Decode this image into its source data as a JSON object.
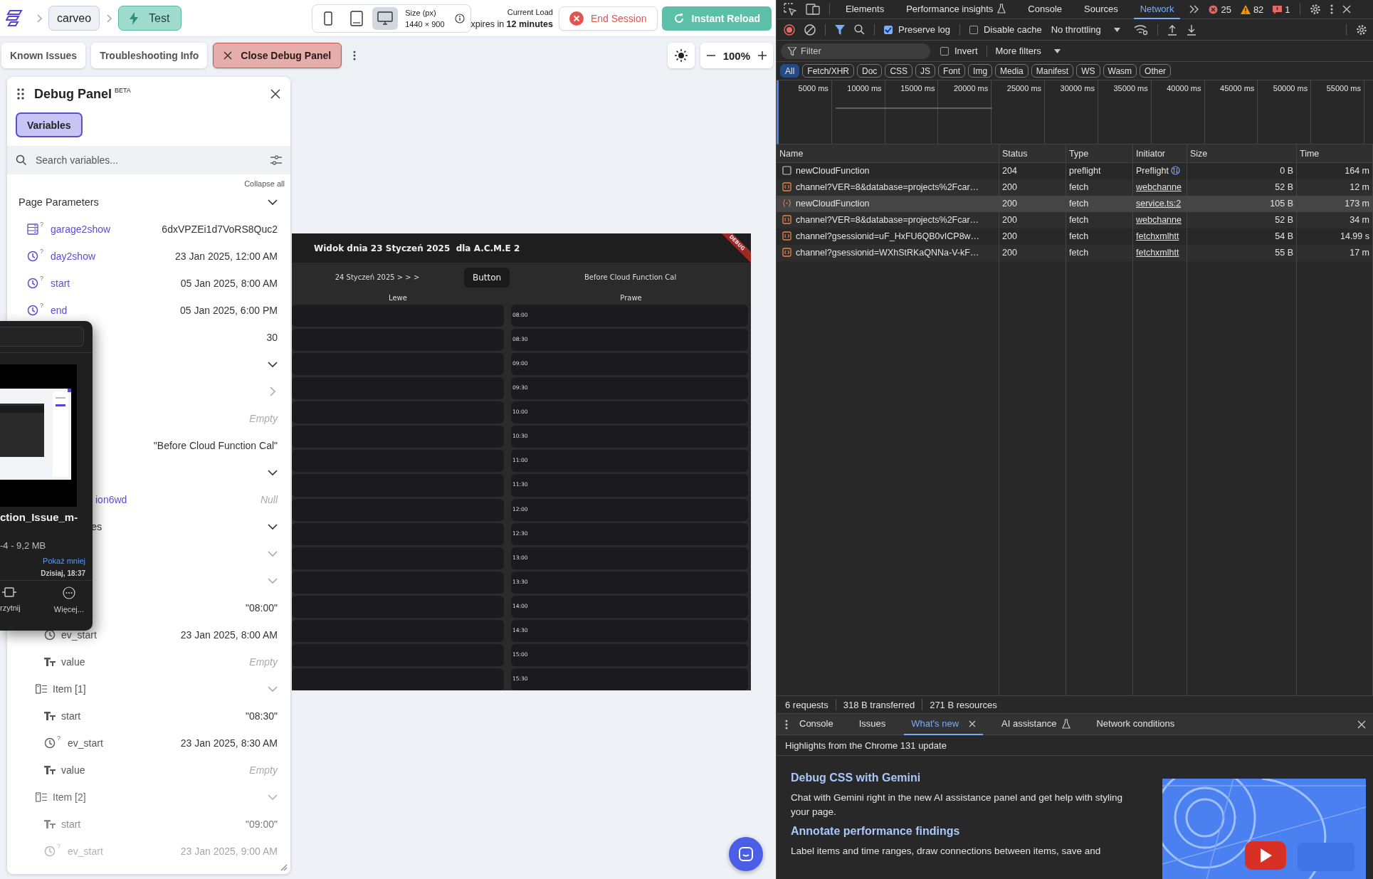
{
  "topbar": {
    "breadcrumbs": [
      {
        "label": "carveo",
        "kind": "project"
      },
      {
        "label": "Test",
        "kind": "mode"
      }
    ],
    "devices": [
      {
        "kind": "phone",
        "selected": false
      },
      {
        "kind": "tablet",
        "selected": false
      },
      {
        "kind": "desktop",
        "selected": true
      }
    ],
    "size_label": "Size (px)",
    "size_value": "1440 × 900",
    "load_label": "Current Load",
    "expiry": "xpires in **12 minutes**",
    "end_button": "End Session",
    "reload_button": "Instant Reload"
  },
  "toolbar": {
    "buttons": [
      {
        "label": "Known Issues",
        "kind": "plain"
      },
      {
        "label": "Troubleshooting Info",
        "kind": "plain"
      },
      {
        "label": "Close Debug Panel",
        "kind": "close"
      }
    ],
    "zoom": "100%"
  },
  "debug_panel": {
    "title": "Debug Panel",
    "badge": "BETA",
    "tabs": [
      {
        "label": "Variables",
        "selected": true
      }
    ],
    "search": {
      "placeholder": "Search variables..."
    },
    "collapse_all": "Collapse all",
    "tree": [
      {
        "name": "Page Parameters",
        "expanded": true,
        "children": [
          {
            "name": "garage2show",
            "kind": "table",
            "mark": "?",
            "linked": true,
            "value": "6dxVPZEi1d7VoRS8Quc2"
          },
          {
            "name": "day2show",
            "kind": "clock",
            "mark": "?",
            "linked": true,
            "value": "23 Jan 2025, 12:00 AM"
          },
          {
            "name": "start",
            "kind": "clock",
            "mark": "?",
            "linked": true,
            "value": "05 Jan 2025, 8:00 AM"
          },
          {
            "name": "end",
            "kind": "clock",
            "mark": "?",
            "linked": true,
            "value": "05 Jan 2025, 6:00 PM"
          },
          {
            "value": "30"
          }
        ]
      },
      {
        "expanded": true,
        "children": [
          {
            "expanded": false
          },
          {
            "value": "Empty",
            "empty": true
          },
          {
            "value": "\"Before Cloud Function Cal\""
          }
        ]
      },
      {
        "expanded": true,
        "children": [
          {
            "name": "ion6wd",
            "cut": true,
            "linked": true,
            "value": "Null",
            "empty": true
          }
        ]
      },
      {
        "name": "es",
        "cut": true,
        "expanded": true,
        "children": [
          {
            "expanded": true,
            "children": [
              {
                "expanded": true,
                "children": [
                  {
                    "value": "\"08:00\""
                  },
                  {
                    "name": "ev_start",
                    "kind": "clock",
                    "value": "23 Jan 2025, 8:00 AM"
                  },
                  {
                    "name": "value",
                    "kind": "text",
                    "value": "Empty",
                    "empty": true
                  }
                ]
              },
              {
                "name": "Item [1]",
                "kind": "list",
                "expanded": true,
                "children": [
                  {
                    "name": "start",
                    "kind": "text",
                    "value": "\"08:30\""
                  },
                  {
                    "name": "ev_start",
                    "kind": "clock",
                    "mark": "?",
                    "value": "23 Jan 2025, 8:30 AM"
                  },
                  {
                    "name": "value",
                    "kind": "text",
                    "value": "Empty",
                    "empty": true
                  }
                ]
              },
              {
                "name": "Item [2]",
                "kind": "list",
                "expanded": true,
                "children": [
                  {
                    "name": "start",
                    "kind": "text",
                    "value": "\"09:00\""
                  },
                  {
                    "name": "ev_start",
                    "kind": "clock",
                    "mark": "?",
                    "value": "23 Jan 2025, 9:00 AM"
                  }
                ]
              }
            ]
          }
        ]
      }
    ]
  },
  "preview": {
    "title": "Widok dnia 23 Styczeń 2025  dla A.C.M.E 2",
    "ribbon": "DEBUG",
    "next_day": "24 Styczeń 2025 > > >",
    "button": "Button",
    "status": "Before Cloud Function Cal",
    "columns": [
      "Lewe",
      "Prawe"
    ],
    "slots": [
      "08:00",
      "08:30",
      "09:00",
      "09:30",
      "10:00",
      "10:30",
      "11:00",
      "11:30",
      "12:00",
      "12:30",
      "13:00",
      "13:30",
      "14:00",
      "14:30",
      "15:00",
      "15:30"
    ]
  },
  "file_preview": {
    "name": "ction_Issue_m-",
    "details": "-4 - 9,2 MB",
    "toggle": "Pokaż mniej",
    "date": "Dzisiaj, 18:37",
    "actions": [
      {
        "label": "rzytnij",
        "kind": "trim"
      },
      {
        "label": "Więcej...",
        "kind": "more"
      }
    ]
  },
  "devtools": {
    "tabs": [
      {
        "label": "Elements",
        "selected": false,
        "kind": "plain"
      },
      {
        "label": "Performance insights",
        "selected": false,
        "kind": "experiment"
      },
      {
        "label": "Console",
        "selected": false,
        "kind": "plain"
      },
      {
        "label": "Sources",
        "selected": false,
        "kind": "plain"
      },
      {
        "label": "Network",
        "selected": true,
        "kind": "plain"
      }
    ],
    "errors": "25",
    "warnings": "82",
    "issues": "1",
    "preserve_log": {
      "label": "Preserve log",
      "checked": true
    },
    "disable_cache": {
      "label": "Disable cache",
      "checked": false
    },
    "throttling": "No throttling",
    "filter": {
      "placeholder": "Filter"
    },
    "invert": {
      "label": "Invert",
      "checked": false
    },
    "more_filters": "More filters",
    "type_filters": [
      {
        "label": "All",
        "selected": true
      },
      {
        "label": "Fetch/XHR",
        "selected": false
      },
      {
        "label": "Doc",
        "selected": false
      },
      {
        "label": "CSS",
        "selected": false
      },
      {
        "label": "JS",
        "selected": false
      },
      {
        "label": "Font",
        "selected": false
      },
      {
        "label": "Img",
        "selected": false
      },
      {
        "label": "Media",
        "selected": false
      },
      {
        "label": "Manifest",
        "selected": false
      },
      {
        "label": "WS",
        "selected": false
      },
      {
        "label": "Wasm",
        "selected": false
      },
      {
        "label": "Other",
        "selected": false
      }
    ],
    "timeline_ticks": [
      "5000 ms",
      "10000 ms",
      "15000 ms",
      "20000 ms",
      "25000 ms",
      "30000 ms",
      "35000 ms",
      "40000 ms",
      "45000 ms",
      "50000 ms",
      "55000 ms"
    ],
    "columns": [
      "Name",
      "Status",
      "Type",
      "Initiator",
      "Size",
      "Time"
    ],
    "requests": [
      {
        "kind": "preflight",
        "name": "newCloudFunction",
        "status": "204",
        "type": "preflight",
        "initiator": "Preflight",
        "size": "0 B",
        "time": "164 m",
        "selected": false
      },
      {
        "kind": "fetch",
        "name": "channel?VER=8&database=projects%2Fcar…",
        "status": "200",
        "type": "fetch",
        "initiator": "webchanne",
        "size": "52 B",
        "time": "12 m",
        "selected": false
      },
      {
        "kind": "script",
        "name": "newCloudFunction",
        "status": "200",
        "type": "fetch",
        "initiator": "service.ts:2",
        "size": "105 B",
        "time": "173 m",
        "selected": true
      },
      {
        "kind": "fetch",
        "name": "channel?VER=8&database=projects%2Fcar…",
        "status": "200",
        "type": "fetch",
        "initiator": "webchanne",
        "size": "52 B",
        "time": "34 m",
        "selected": false
      },
      {
        "kind": "fetch",
        "name": "channel?gsessionid=uF_HxFU6QB0vICP8w…",
        "status": "200",
        "type": "fetch",
        "initiator": "fetchxmlhtt",
        "size": "54 B",
        "time": "14.99 s",
        "selected": false
      },
      {
        "kind": "fetch",
        "name": "channel?gsessionid=WXhStRKaQNNa-V-kF…",
        "status": "200",
        "type": "fetch",
        "initiator": "fetchxmlhtt",
        "size": "55 B",
        "time": "17 m",
        "selected": false
      }
    ],
    "summary": [
      "6 requests",
      "318 B transferred",
      "271 B resources"
    ],
    "drawer_tabs": [
      {
        "label": "Console",
        "selected": false,
        "closable": false,
        "kind": "plain"
      },
      {
        "label": "Issues",
        "selected": false,
        "closable": false,
        "kind": "plain"
      },
      {
        "label": "What's new",
        "selected": true,
        "closable": true,
        "kind": "plain"
      },
      {
        "label": "AI assistance",
        "selected": false,
        "closable": false,
        "kind": "experiment"
      },
      {
        "label": "Network conditions",
        "selected": false,
        "closable": false,
        "kind": "plain"
      }
    ],
    "highlights": "Highlights from the Chrome 131 update",
    "articles": [
      {
        "title": "Debug CSS with Gemini",
        "text": "Chat with Gemini right in the new AI assistance panel and get help with styling your page."
      },
      {
        "title": "Annotate performance findings",
        "text": "Label items and time ranges, draw connections between items, save and"
      }
    ],
    "video": {
      "kind": "picture"
    }
  }
}
